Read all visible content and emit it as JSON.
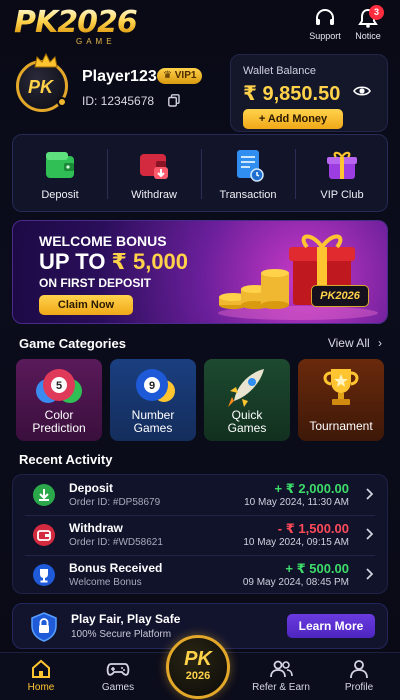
{
  "header": {
    "logo_main": "PK2026",
    "logo_sub": "GAME",
    "support_label": "Support",
    "notice_label": "Notice",
    "notice_count": "3"
  },
  "profile": {
    "username": "Player123",
    "vip_level": "VIP1",
    "user_id": "ID: 12345678",
    "avatar_text": "PK"
  },
  "wallet": {
    "label": "Wallet Balance",
    "amount": "₹ 9,850.50",
    "add_money_label": "+ Add Money"
  },
  "quick_actions": [
    {
      "label": "Deposit",
      "icon": "deposit-wallet-icon",
      "color": "#2fbf55"
    },
    {
      "label": "Withdraw",
      "icon": "withdraw-wallet-icon",
      "color": "#e0344a"
    },
    {
      "label": "Transaction",
      "icon": "transaction-document-icon",
      "color": "#2f8ef0"
    },
    {
      "label": "VIP Club",
      "icon": "vip-gift-icon",
      "color": "#a04ae0"
    }
  ],
  "banner": {
    "line1": "WELCOME BONUS",
    "line2_prefix": "UP TO ",
    "line2_amount": "₹ 5,000",
    "line3": "ON FIRST DEPOSIT",
    "cta": "Claim Now",
    "logo": "PK2026"
  },
  "games": {
    "title": "Game Categories",
    "view_all": "View All",
    "items": [
      {
        "line1": "Color",
        "line2": "Prediction",
        "icon": "color-ball-5-icon"
      },
      {
        "line1": "Number",
        "line2": "Games",
        "icon": "number-ball-9-icon"
      },
      {
        "line1": "Quick",
        "line2": "Games",
        "icon": "rocket-icon"
      },
      {
        "line1": "Tournament",
        "line2": "",
        "icon": "trophy-icon"
      }
    ]
  },
  "activity": {
    "title": "Recent Activity",
    "rows": [
      {
        "title": "Deposit",
        "order": "Order ID: #DP58679",
        "amount": "+ ₹ 2,000.00",
        "date": "10 May 2024, 11:30 AM",
        "color": "#3ddc6a"
      },
      {
        "title": "Withdraw",
        "order": "Order ID: #WD58621",
        "amount": "- ₹ 1,500.00",
        "date": "10 May 2024, 09:15 AM",
        "color": "#ff4a5a"
      },
      {
        "title": "Bonus Received",
        "order": "Welcome Bonus",
        "amount": "+ ₹ 500.00",
        "date": "09 May 2024, 08:45 PM",
        "color": "#3ddc6a"
      }
    ]
  },
  "fair_play": {
    "title": "Play Fair, Play Safe",
    "subtitle": "100% Secure Platform",
    "cta": "Learn More"
  },
  "nav": {
    "home": "Home",
    "games": "Games",
    "center_pk": "PK",
    "center_year": "2026",
    "refer": "Refer & Earn",
    "profile": "Profile"
  }
}
